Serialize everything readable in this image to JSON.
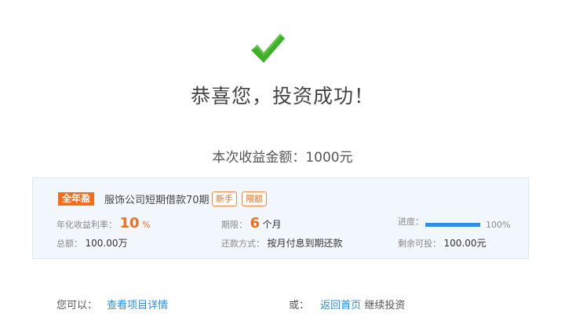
{
  "success": {
    "title": "恭喜您，投资成功！",
    "amount_text": "本次收益金额：1000元"
  },
  "product": {
    "tag_year": "全年盈",
    "name": "服饰公司短期借款70期",
    "tag_new": "新手",
    "tag_limit": "限额",
    "rate_label": "年化收益利率：",
    "rate_value": "10",
    "rate_unit": "%",
    "total_label": "总额：",
    "total_value": "100.00万",
    "period_label": "期限：",
    "period_value": "6",
    "period_unit": "个月",
    "repay_label": "还款方式：",
    "repay_value": "按月付息到期还款",
    "progress_label": "进度：",
    "progress_value": 1.0,
    "progress_text": "100%",
    "remaining_label": "剩余可投：",
    "remaining_value": "100.00元"
  },
  "footer": {
    "you_can": "您可以：",
    "view_details": "查看项目详情",
    "or": "或：",
    "back_home": "返回首页",
    "continue": "继续投资"
  },
  "colors": {
    "check": "#3fae29",
    "accent": "#f06e1e",
    "link": "#2a8de6",
    "progress": "#2f8fe6"
  },
  "icons": {
    "success": "checkmark-icon"
  }
}
